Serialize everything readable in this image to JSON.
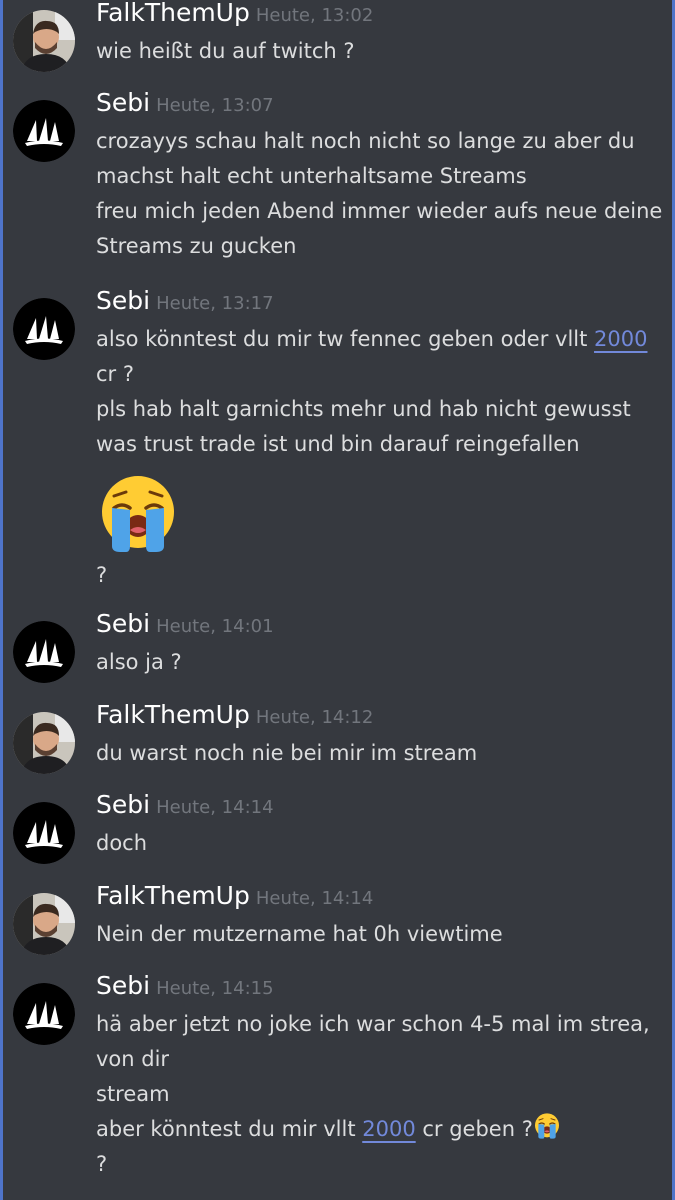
{
  "messages": [
    {
      "author": "FalkThemUp",
      "avatar": "person-avatar",
      "time": "Heute, 13:02",
      "lines": [
        "wie heißt du auf twitch ?"
      ]
    },
    {
      "author": "Sebi",
      "avatar": "sail-logo-avatar",
      "time": "Heute, 13:07",
      "lines": [
        "crozayys schau halt noch nicht so lange zu aber du",
        "machst halt echt unterhaltsame Streams",
        "freu mich jeden Abend immer wieder aufs neue deine",
        "Streams zu gucken"
      ]
    },
    {
      "author": "Sebi",
      "avatar": "sail-logo-avatar",
      "time": "Heute, 13:17",
      "line1_pre": "also könntest du mir tw fennec geben oder vllt ",
      "line1_link": "2000",
      "lines": [
        "cr ?",
        "pls hab halt garnichts mehr und hab nicht gewusst",
        "was trust trade ist und bin darauf reingefallen"
      ],
      "emoji": "loudly-crying-face",
      "after_emoji": "?"
    },
    {
      "author": "Sebi",
      "avatar": "sail-logo-avatar",
      "time": "Heute, 14:01",
      "lines": [
        "also ja ?"
      ]
    },
    {
      "author": "FalkThemUp",
      "avatar": "person-avatar",
      "time": "Heute, 14:12",
      "lines": [
        "du warst noch nie bei mir im stream"
      ]
    },
    {
      "author": "Sebi",
      "avatar": "sail-logo-avatar",
      "time": "Heute, 14:14",
      "lines": [
        "doch"
      ]
    },
    {
      "author": "FalkThemUp",
      "avatar": "person-avatar",
      "time": "Heute, 14:14",
      "lines": [
        "Nein der mutzername hat 0h viewtime"
      ]
    },
    {
      "author": "Sebi",
      "avatar": "sail-logo-avatar",
      "time": "Heute, 14:15",
      "lines": [
        "hä aber jetzt no joke ich war schon 4-5 mal im strea,",
        "von dir",
        "stream"
      ],
      "line4_pre": "aber könntest du mir vllt ",
      "line4_link": "2000",
      "line4_post": " cr geben ?",
      "emoji": "loudly-crying-face",
      "last": "?"
    }
  ],
  "colors": {
    "background": "#36393f",
    "text": "#dcddde",
    "username": "#ffffff",
    "timestamp": "#72767d",
    "link": "#7289da"
  }
}
